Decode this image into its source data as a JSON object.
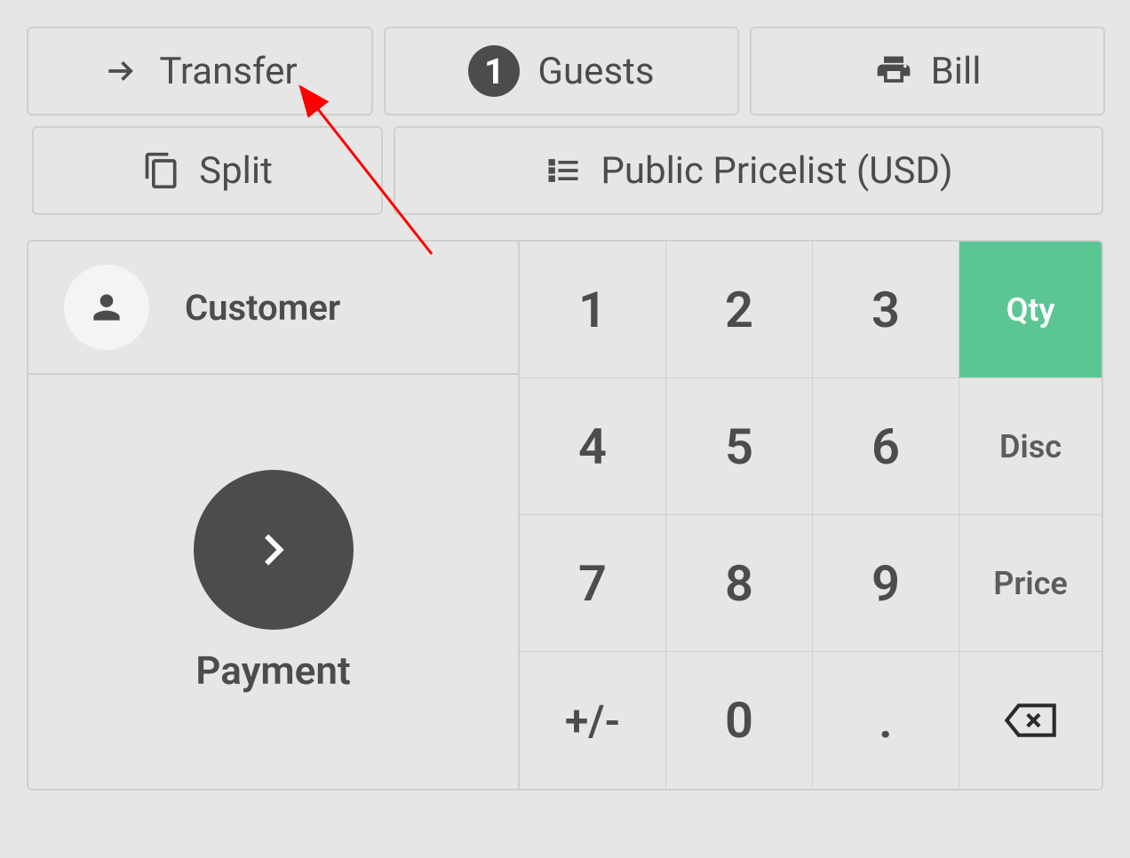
{
  "actions": {
    "transfer_label": "Transfer",
    "guests_label": "Guests",
    "guests_count": "1",
    "bill_label": "Bill",
    "split_label": "Split",
    "pricelist_label": "Public Pricelist (USD)"
  },
  "customer": {
    "label": "Customer"
  },
  "payment": {
    "label": "Payment"
  },
  "numpad": {
    "k1": "1",
    "k2": "2",
    "k3": "3",
    "k4": "4",
    "k5": "5",
    "k6": "6",
    "k7": "7",
    "k8": "8",
    "k9": "9",
    "k0": "0",
    "plusminus": "+/-",
    "dot": ".",
    "qty": "Qty",
    "disc": "Disc",
    "price": "Price"
  }
}
